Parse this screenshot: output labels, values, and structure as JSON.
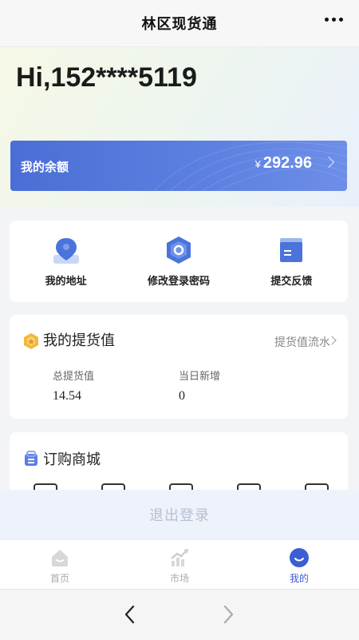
{
  "topbar": {
    "title": "林区现货通",
    "more_icon": "more-dots-icon"
  },
  "greeting": "Hi,152****5119",
  "balance": {
    "label": "我的余额",
    "currency": "¥",
    "amount": "292.96"
  },
  "quick_actions": [
    {
      "label": "我的地址",
      "icon": "location-pin-icon"
    },
    {
      "label": "修改登录密码",
      "icon": "hexagon-lock-icon"
    },
    {
      "label": "提交反馈",
      "icon": "feedback-folder-icon"
    }
  ],
  "pickup": {
    "title": "我的提货值",
    "link": "提货值流水",
    "stats": [
      {
        "label": "总提货值",
        "value": "14.54"
      },
      {
        "label": "当日新增",
        "value": "0"
      }
    ]
  },
  "mall": {
    "title": "订购商城"
  },
  "logout_label": "退出登录",
  "tabs": [
    {
      "label": "首页",
      "icon": "home-icon",
      "active": false
    },
    {
      "label": "市场",
      "icon": "market-chart-icon",
      "active": false
    },
    {
      "label": "我的",
      "icon": "profile-icon",
      "active": true
    }
  ],
  "colors": {
    "accent": "#3b5ed4",
    "card_gradient_start": "#4b6ed6",
    "card_gradient_end": "#6d8ee8"
  }
}
